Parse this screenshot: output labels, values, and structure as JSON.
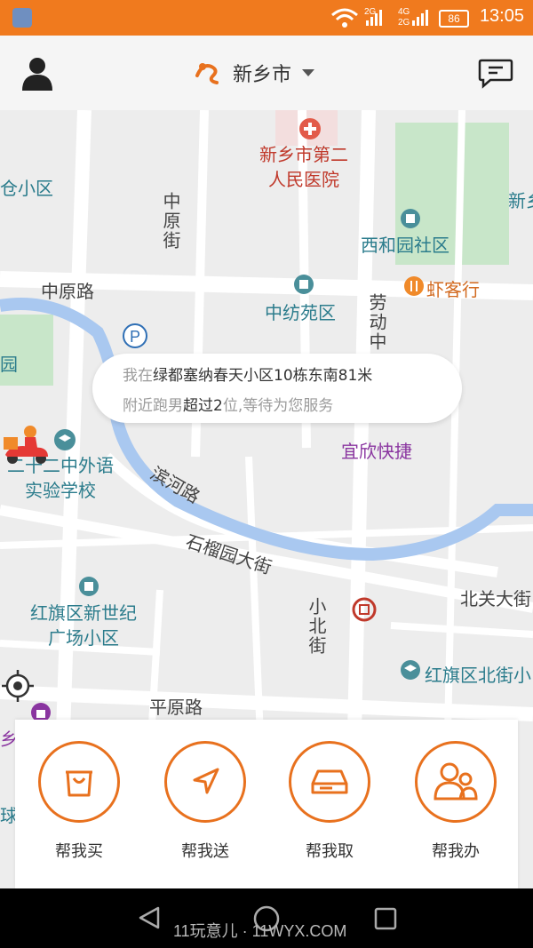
{
  "status_bar": {
    "time": "13:05",
    "battery": "86",
    "net_1": "2G",
    "net_2": "4G",
    "net_3": "2G"
  },
  "header": {
    "city": "新乡市",
    "icons": [
      "user-icon",
      "logo-icon",
      "dropdown-icon",
      "message-icon"
    ]
  },
  "map": {
    "roads": {
      "zhongyuan_road": "中原路",
      "zhongyuan_street": "中原街",
      "laodong_street": "劳动中",
      "binhe_road": "滨河路",
      "shiliuyuan_street": "石榴园大街",
      "beiguan_street": "北关大街",
      "xiaobei_street": "小北街",
      "pingyuan_road": "平原路"
    },
    "pois": {
      "hospital": "新乡市第二\n人民医院",
      "xiheyuan": "西和园社区",
      "xiakexing": "虾客行",
      "zhongfangyuan": "中纺苑区",
      "school": "二十二中外语\n实验学校",
      "yixin": "宜欣快捷",
      "hongqi_xinshiji": "红旗区新世纪\n广场小区",
      "hongqi_beijie": "红旗区北街小",
      "edge_left_1": "仓小区",
      "edge_left_2": "园",
      "edge_left_3": "乡币",
      "edge_left_4": "球",
      "edge_right_1": "新乡"
    },
    "bubble": {
      "line1_prefix": "我在",
      "line1_address": "绿都塞纳春天小区10栋东南81米",
      "line2_prefix": "附近跑男",
      "line2_count": "超过2",
      "line2_suffix": "位,等待为您服务"
    }
  },
  "actions": [
    {
      "label": "帮我买",
      "icon": "shopping-bag-icon"
    },
    {
      "label": "帮我送",
      "icon": "navigation-arrow-icon"
    },
    {
      "label": "帮我取",
      "icon": "drive-box-icon"
    },
    {
      "label": "帮我办",
      "icon": "people-icon"
    }
  ],
  "nav_bar": {
    "watermark": "11玩意儿 · 11WYX.COM"
  },
  "colors": {
    "accent": "#e8711e",
    "status_bar": "#f07a1e",
    "river": "#a9c8f0",
    "park": "#c8e6c9"
  }
}
